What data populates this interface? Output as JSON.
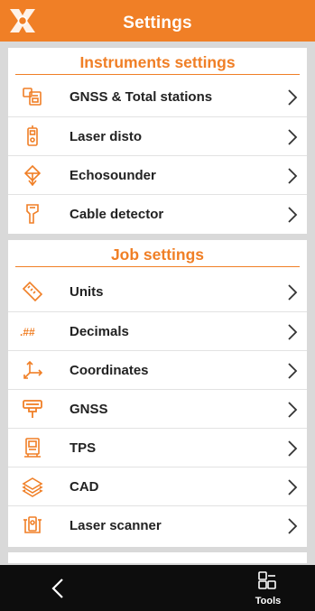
{
  "header": {
    "title": "Settings",
    "logo_icon": "x-logo-icon"
  },
  "colors": {
    "accent": "#f07f26",
    "background": "#d9d9d9",
    "bottom_bar": "#0d0d0d"
  },
  "instruments": {
    "title": "Instruments settings",
    "items": [
      {
        "label": "GNSS & Total stations",
        "icon": "gnss-total-station-icon"
      },
      {
        "label": "Laser disto",
        "icon": "laser-disto-icon"
      },
      {
        "label": "Echosounder",
        "icon": "echosounder-icon"
      },
      {
        "label": "Cable detector",
        "icon": "cable-detector-icon"
      }
    ]
  },
  "job": {
    "title": "Job settings",
    "items": [
      {
        "label": "Units",
        "icon": "ruler-icon"
      },
      {
        "label": "Decimals",
        "icon": "decimals-icon",
        "glyph": ".##"
      },
      {
        "label": "Coordinates",
        "icon": "coordinates-axes-icon"
      },
      {
        "label": "GNSS",
        "icon": "gnss-receiver-icon"
      },
      {
        "label": "TPS",
        "icon": "tps-icon"
      },
      {
        "label": "CAD",
        "icon": "cad-layers-icon"
      },
      {
        "label": "Laser scanner",
        "icon": "laser-scanner-icon"
      }
    ]
  },
  "bottom_bar": {
    "back_icon": "back-chevron-icon",
    "tools_label": "Tools",
    "tools_icon": "tools-grid-icon"
  }
}
